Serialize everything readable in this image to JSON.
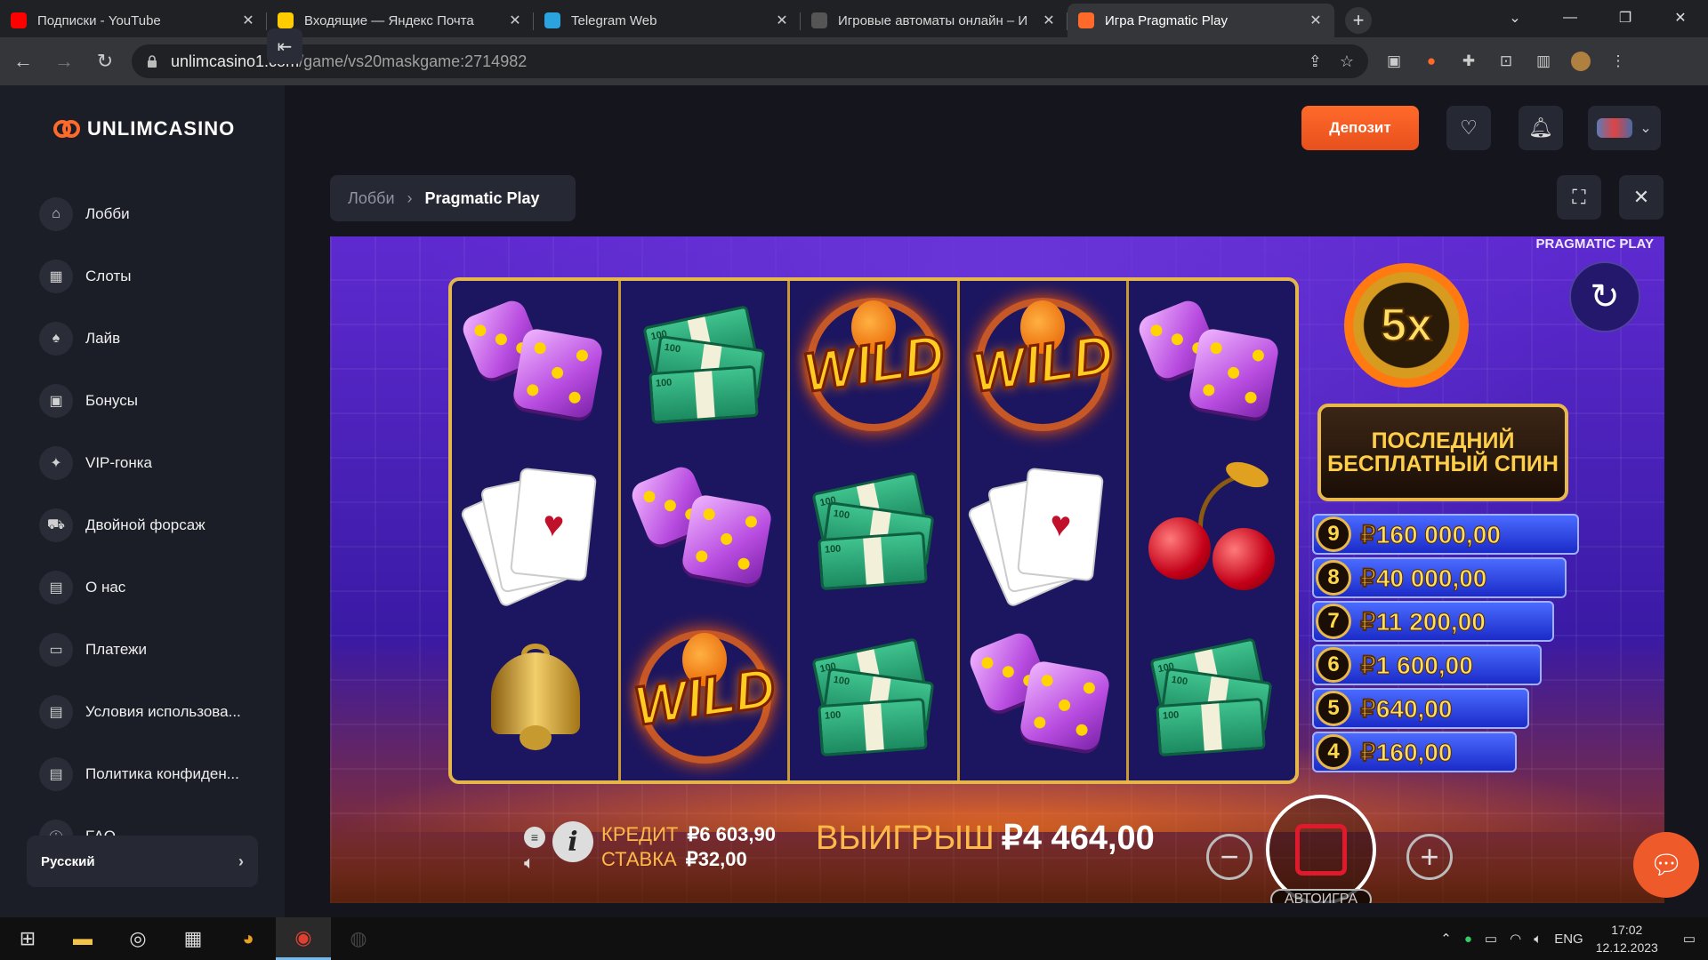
{
  "browser": {
    "tabs": [
      {
        "title": "Подписки - YouTube",
        "favicon_color": "#ff0000",
        "active": false
      },
      {
        "title": "Входящие — Яндекс Почта",
        "favicon_color": "#ffcc00",
        "active": false
      },
      {
        "title": "Telegram Web",
        "favicon_color": "#2aa3df",
        "active": false
      },
      {
        "title": "Игровые автоматы онлайн – И",
        "favicon_color": "#555555",
        "active": false
      },
      {
        "title": "Игра Pragmatic Play",
        "favicon_color": "#ff6a2b",
        "active": true
      }
    ],
    "url_host": "unlimcasino1.com",
    "url_path": "/game/vs20maskgame:2714982"
  },
  "site": {
    "logo_text": "UNLIMCASINO",
    "brand_color": "#ff6a2b",
    "menu": [
      {
        "label": "Лобби",
        "icon": "home-icon"
      },
      {
        "label": "Слоты",
        "icon": "grid-icon"
      },
      {
        "label": "Лайв",
        "icon": "spade-icon"
      },
      {
        "label": "Бонусы",
        "icon": "bonus-icon"
      },
      {
        "label": "VIP-гонка",
        "icon": "sparkle-icon"
      },
      {
        "label": "Двойной форсаж",
        "icon": "car-icon"
      },
      {
        "label": "О нас",
        "icon": "document-icon"
      },
      {
        "label": "Платежи",
        "icon": "wallet-icon"
      },
      {
        "label": "Условия использова...",
        "icon": "document-icon"
      },
      {
        "label": "Политика конфиден...",
        "icon": "document-icon"
      },
      {
        "label": "FAQ",
        "icon": "info-icon"
      }
    ],
    "language": "Русский",
    "deposit_label": "Депозит",
    "breadcrumb": {
      "lobby": "Лобби",
      "current": "Pragmatic Play"
    }
  },
  "game": {
    "provider_logo": "PRAGMATIC PLAY",
    "multiplier": "5x",
    "last_spin_text": "ПОСЛЕДНИЙ БЕСПЛАТНЫЙ СПИН",
    "ladder": [
      {
        "n": "9",
        "value": "₽160 000,00"
      },
      {
        "n": "8",
        "value": "₽40 000,00"
      },
      {
        "n": "7",
        "value": "₽11 200,00"
      },
      {
        "n": "6",
        "value": "₽1 600,00"
      },
      {
        "n": "5",
        "value": "₽640,00"
      },
      {
        "n": "4",
        "value": "₽160,00"
      }
    ],
    "reels": [
      [
        "dice",
        "cards",
        "bell"
      ],
      [
        "cash",
        "dice",
        "wild"
      ],
      [
        "wild",
        "cash",
        "cash"
      ],
      [
        "wild",
        "cards",
        "dice"
      ],
      [
        "dice",
        "cherry",
        "cash"
      ]
    ],
    "wild_text": "WILD",
    "bill_text": "100",
    "card_suit": "♥",
    "credit_label": "КРЕДИТ",
    "credit_value": "₽6 603,90",
    "bet_label": "СТАВКА",
    "bet_value": "₽32,00",
    "win_label": "ВЫИГРЫШ",
    "win_value": "₽4 464,00",
    "autoplay_label": "АВТОИГРА",
    "info_glyph": "i"
  },
  "taskbar": {
    "lang": "ENG",
    "time": "17:02",
    "date": "12.12.2023"
  }
}
